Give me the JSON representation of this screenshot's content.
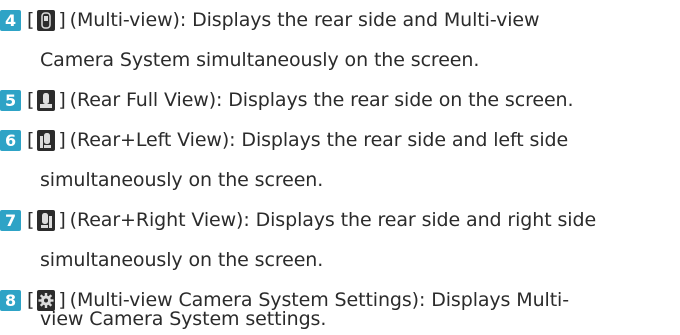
{
  "items": [
    {
      "num": "4",
      "text1": "(Multi-view): Displays the rear side and Multi-view",
      "text2": "Camera System simultaneously on the screen.",
      "icon": "multi-view-icon"
    },
    {
      "num": "5",
      "text1": "(Rear Full View): Displays the rear side on the screen.",
      "icon": "rear-full-view-icon"
    },
    {
      "num": "6",
      "text1": "(Rear+Left View): Displays the rear side and left side",
      "text2": "simultaneously on the screen.",
      "icon": "rear-left-view-icon"
    },
    {
      "num": "7",
      "text1": "(Rear+Right View): Displays the rear side and right side",
      "text2": "simultaneously on the screen.",
      "icon": "rear-right-view-icon"
    },
    {
      "num": "8",
      "text1": "(Multi-view Camera System Settings): Displays Multi-",
      "text2": "view Camera System settings.",
      "icon": "settings-gear-icon"
    }
  ],
  "bracket_open": "[",
  "bracket_close": "]",
  "accent_color": "#2ea3c6"
}
